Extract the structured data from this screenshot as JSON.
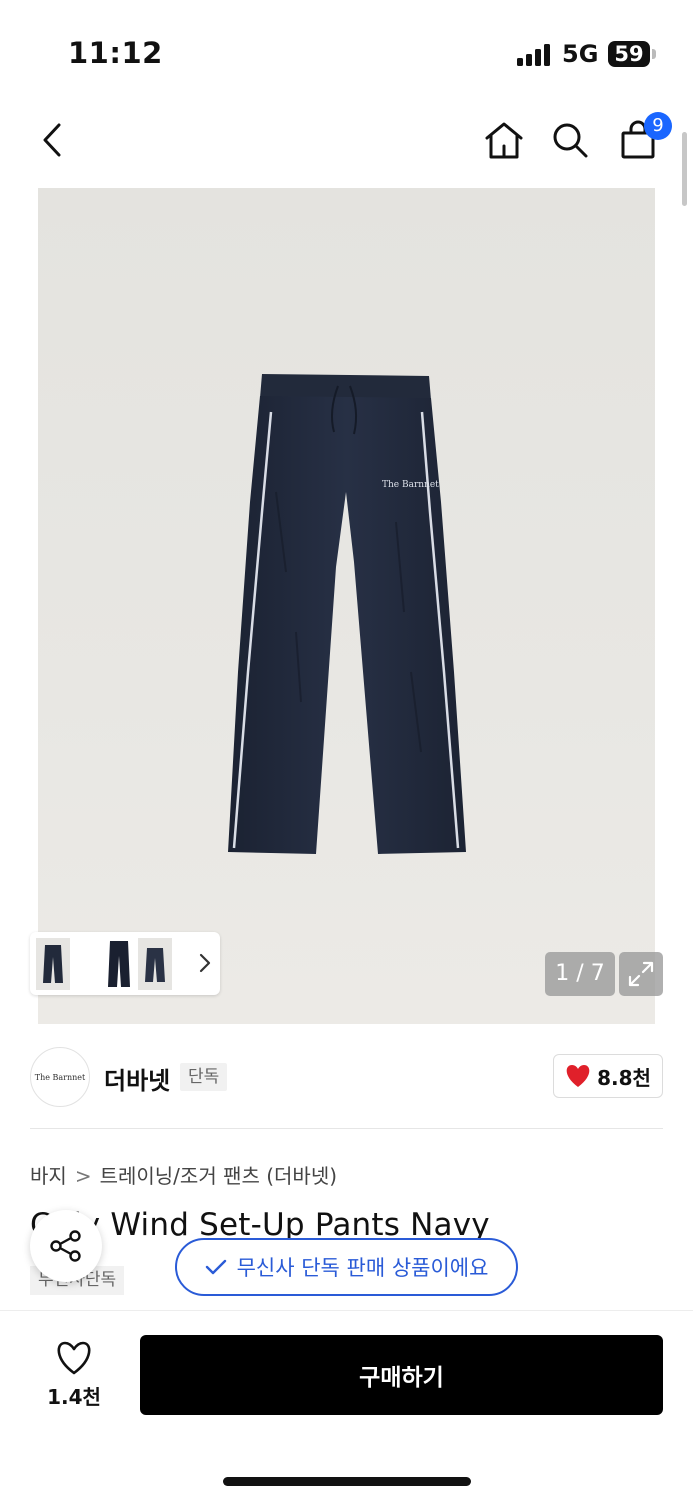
{
  "status_bar": {
    "time": "11:12",
    "network": "5G",
    "battery": "59"
  },
  "nav": {
    "cart_count": "9"
  },
  "gallery": {
    "page_counter": "1 / 7",
    "current_page": 1,
    "total_pages": 7,
    "image_logo_text": "The Barnnet"
  },
  "brand": {
    "logo_text": "The Barnnet",
    "name": "더바넷",
    "exclusive_label": "단독",
    "like_count": "8.8천"
  },
  "breadcrumb": [
    "바지",
    "트레이닝/조거 팬츠 (더바넷)"
  ],
  "product": {
    "title": "C  dy Wind Set-Up Pants  Navy",
    "tag": "무신사단독"
  },
  "toast": {
    "text": "무신사 단독 판매 상품이에요"
  },
  "bottom": {
    "wish_count": "1.4천",
    "buy_label": "구매하기"
  },
  "colors": {
    "accent": "#2a5bd7",
    "badge": "#1a66ff",
    "heart": "#e0202a",
    "pants": "#222a3a"
  }
}
